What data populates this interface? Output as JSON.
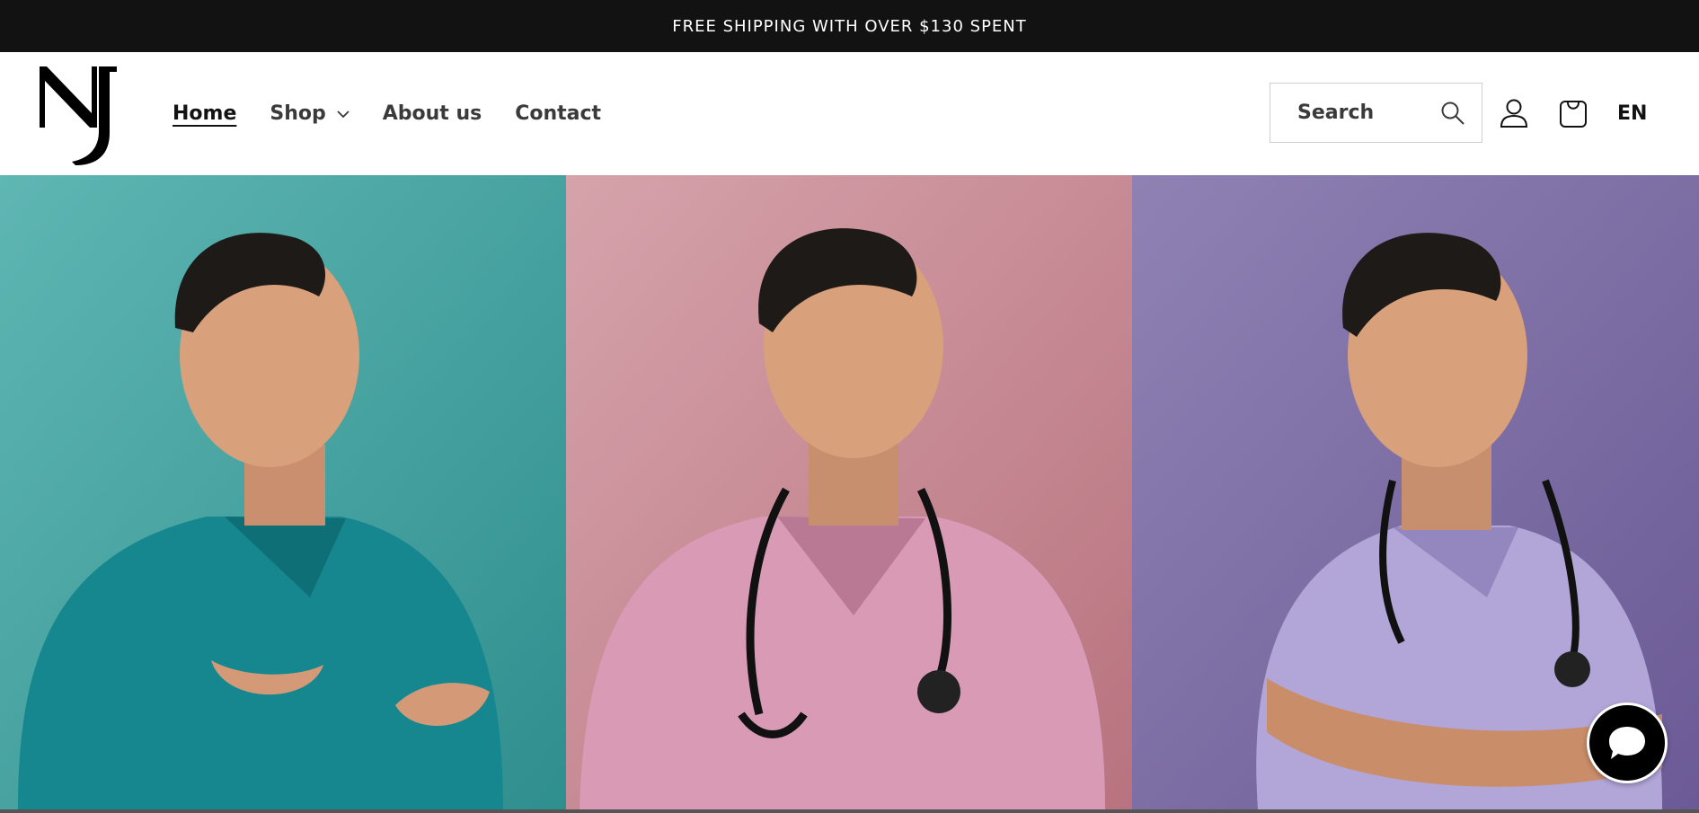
{
  "announcement": {
    "text": "FREE SHIPPING WITH OVER $130 SPENT"
  },
  "header": {
    "logo_icon": "nj-monogram-logo",
    "nav": [
      {
        "label": "Home",
        "active": true
      },
      {
        "label": "Shop",
        "has_dropdown": true
      },
      {
        "label": "About us"
      },
      {
        "label": "Contact"
      }
    ],
    "search": {
      "label": "Search",
      "icon": "search-icon"
    },
    "account_icon": "user-icon",
    "cart_icon": "bag-icon",
    "language": "EN"
  },
  "hero": {
    "panels": [
      {
        "subject": "teal-scrubs-portrait",
        "background": "#3b9e9c",
        "scrub_color": "#1a8d93"
      },
      {
        "subject": "pink-scrubs-portrait",
        "background": "#c98b96",
        "scrub_color": "#d59ab3"
      },
      {
        "subject": "lavender-scrubs-portrait",
        "background": "#7f6fa6",
        "scrub_color": "#b0a4d6"
      }
    ]
  },
  "chat_widget": {
    "icon": "chat-bubble-icon"
  },
  "colors": {
    "announcement_bg": "#121212",
    "header_bg": "#ffffff",
    "text": "#121212"
  }
}
